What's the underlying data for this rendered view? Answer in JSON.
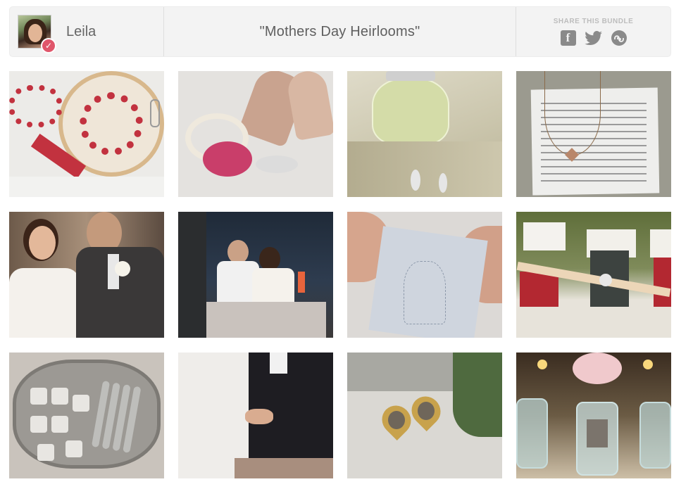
{
  "user": {
    "name": "Leila",
    "verified_icon": "check-badge-icon"
  },
  "bundle": {
    "title": "\"Mothers Day Heirlooms\""
  },
  "share": {
    "label": "SHARE THIS BUNDLE",
    "icons": [
      "facebook-icon",
      "twitter-icon",
      "stumbleupon-icon"
    ],
    "facebook_glyph": "f"
  },
  "colors": {
    "header_bg": "#f3f3f3",
    "icon_grey": "#8a8a8a",
    "badge": "#e0566b"
  },
  "tiles": [
    {
      "name": "embroidery-hoop-photo"
    },
    {
      "name": "rose-heels-garter-photo"
    },
    {
      "name": "chanel-perfume-earrings-photo"
    },
    {
      "name": "necklace-letter-photo"
    },
    {
      "name": "couple-toast-photo"
    },
    {
      "name": "reception-table-photo"
    },
    {
      "name": "handkerchief-photo"
    },
    {
      "name": "book-brooch-escort-cards-photo"
    },
    {
      "name": "silver-tray-spoons-photo"
    },
    {
      "name": "bride-groom-seated-photo"
    },
    {
      "name": "bouquet-locket-photo"
    },
    {
      "name": "mason-jar-photos-photo"
    }
  ]
}
